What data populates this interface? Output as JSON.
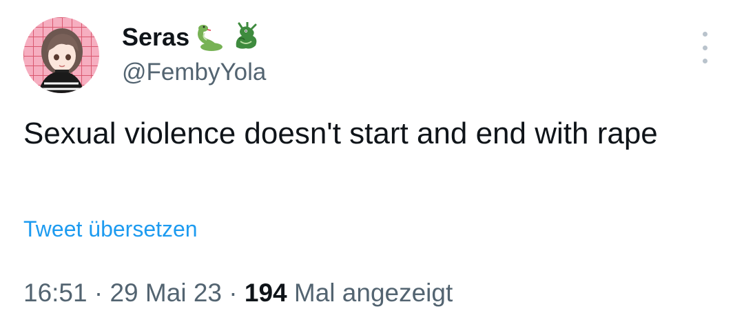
{
  "author": {
    "display_name": "Seras",
    "handle": "@FembyYola",
    "name_emojis": [
      "snake-icon",
      "dragon-icon"
    ]
  },
  "tweet": {
    "text": "Sexual violence doesn't start and end with rape",
    "translate_label": "Tweet übersetzen"
  },
  "meta": {
    "time": "16:51",
    "separator": " · ",
    "date": "29 Mai 23",
    "views_count": "194",
    "views_label": "Mal angezeigt"
  },
  "colors": {
    "link": "#1d9bf0",
    "secondary_text": "#536471",
    "primary_text": "#0f1419"
  }
}
